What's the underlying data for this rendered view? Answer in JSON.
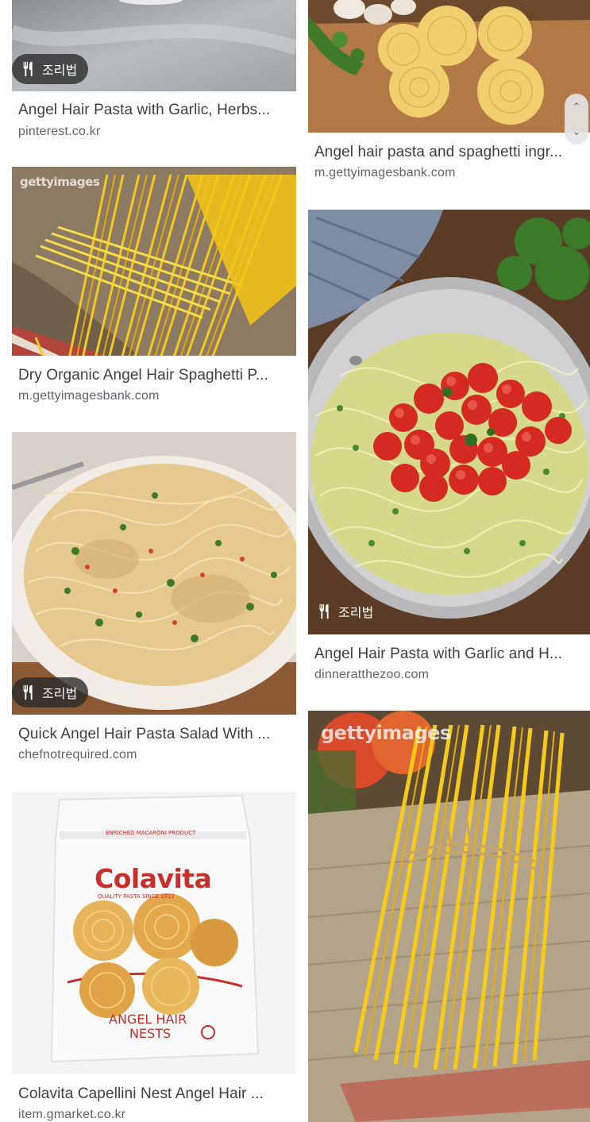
{
  "results": [
    {
      "title": "Angel Hair Pasta with Garlic, Herbs...",
      "source": "pinterest.co.kr",
      "badge": "조리법"
    },
    {
      "title": "Angel hair pasta and spaghetti ingr...",
      "source": "m.gettyimagesbank.com"
    },
    {
      "title": "Dry Organic Angel Hair Spaghetti P...",
      "source": "m.gettyimagesbank.com",
      "watermark": "gettyimages"
    },
    {
      "title": "Angel Hair Pasta with Garlic and H...",
      "source": "dinneratthezoo.com",
      "badge": "조리법"
    },
    {
      "title": "Quick Angel Hair Pasta Salad With ...",
      "source": "chefnotrequired.com",
      "badge": "조리법"
    },
    {
      "title": "Colavita Capellini Nest Angel Hair ...",
      "source": "item.gmarket.co.kr",
      "package": {
        "top": "ENRICHED MACARONI PRODUCT",
        "brand": "Colavita",
        "sub": "QUALITY PASTA SINCE 1912",
        "line1": "ANGEL HAIR",
        "line2": "NESTS"
      }
    },
    {
      "watermark": "gettyimages"
    }
  ],
  "scroll_icons": {
    "up": "chevron-up-icon",
    "down": "chevron-down-icon"
  }
}
